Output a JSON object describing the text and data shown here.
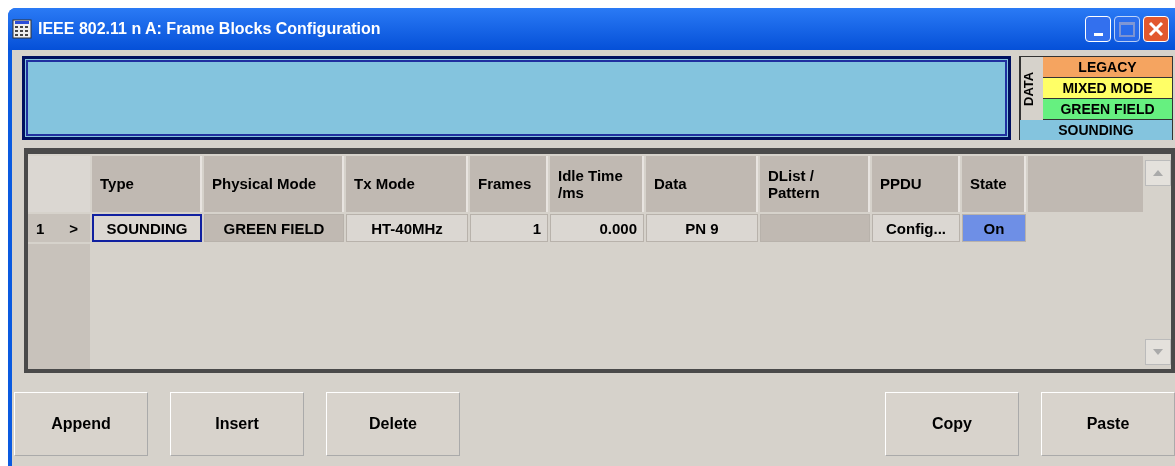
{
  "window": {
    "title": "IEEE 802.11 n A: Frame Blocks Configuration"
  },
  "legend": {
    "label": "DATA",
    "items": [
      {
        "label": "LEGACY",
        "color": "#f5a460"
      },
      {
        "label": "MIXED MODE",
        "color": "#ffff66"
      },
      {
        "label": "GREEN FIELD",
        "color": "#66f080"
      },
      {
        "label": "SOUNDING",
        "color": "#84c4de"
      }
    ]
  },
  "table": {
    "columns": [
      "Type",
      "Physical Mode",
      "Tx Mode",
      "Frames",
      "Idle Time /ms",
      "Data",
      "DList / Pattern",
      "PPDU",
      "State"
    ],
    "rows": [
      {
        "index": "1",
        "marker": ">",
        "cells": [
          {
            "kind": "edit",
            "text": "SOUNDING",
            "selected": true
          },
          {
            "kind": "readonly",
            "text": "GREEN FIELD",
            "selected": false
          },
          {
            "kind": "edit",
            "text": "HT-40MHz",
            "selected": false
          },
          {
            "kind": "number",
            "text": "1",
            "selected": false
          },
          {
            "kind": "number",
            "text": "0.000",
            "selected": false
          },
          {
            "kind": "edit",
            "text": "PN  9",
            "selected": false
          },
          {
            "kind": "readonly",
            "selected": false
          },
          {
            "kind": "button",
            "text": "Config...",
            "selected": false
          },
          {
            "kind": "state",
            "text": "On",
            "on": true,
            "selected": false
          }
        ]
      }
    ]
  },
  "buttons": {
    "left": [
      "Append",
      "Insert",
      "Delete"
    ],
    "right": [
      "Copy",
      "Paste"
    ]
  }
}
